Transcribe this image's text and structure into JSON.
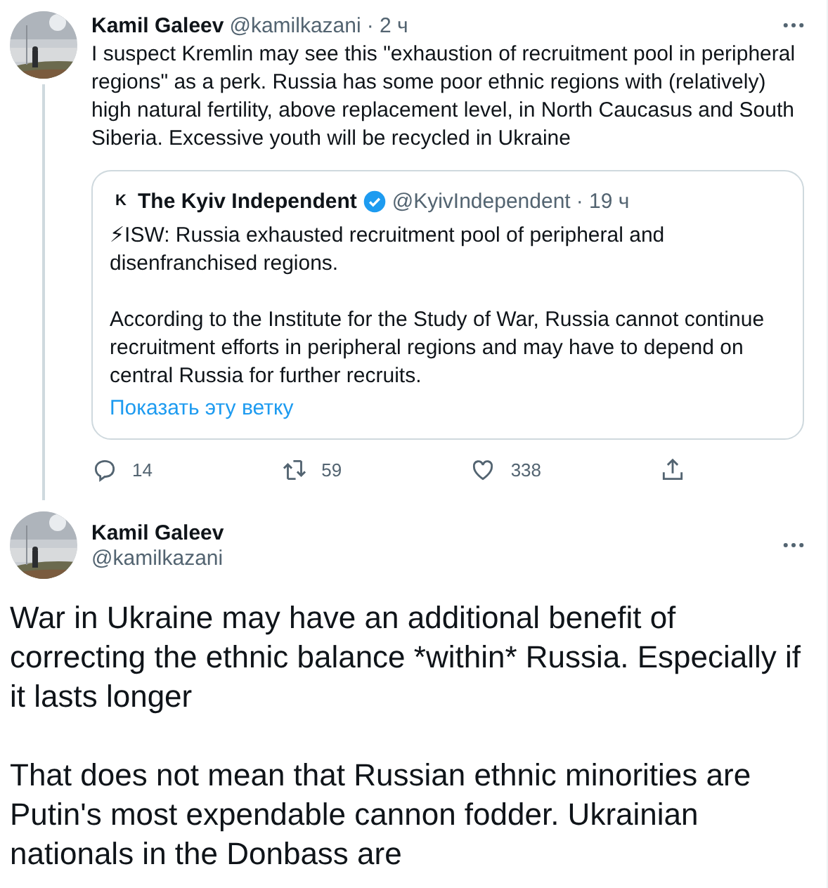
{
  "tweets": [
    {
      "name": "Kamil Galeev",
      "handle": "@kamilkazani",
      "time": "· 2 ч",
      "text": "I suspect Kremlin may see this \"exhaustion of recruitment pool in peripheral regions\" as a perk. Russia has some poor ethnic regions with (relatively) high natural fertility, above replacement level, in North Caucasus and South Siberia. Excessive youth will be recycled in Ukraine",
      "quote": {
        "logo": "K",
        "name": "The Kyiv Independent",
        "verified": true,
        "handle": "@KyivIndependent",
        "time": "· 19 ч",
        "paragraphs": [
          "⚡ISW: Russia exhausted recruitment pool of peripheral and disenfranchised regions.",
          "According to the Institute for the Study of War, Russia cannot continue recruitment efforts in peripheral regions and may have to depend on central Russia for further recruits."
        ],
        "link": "Показать эту ветку"
      },
      "actions": [
        {
          "kind": "reply",
          "count": "14"
        },
        {
          "kind": "retweet",
          "count": "59"
        },
        {
          "kind": "like",
          "count": "338"
        },
        {
          "kind": "share"
        }
      ]
    }
  ],
  "focused": {
    "name": "Kamil Galeev",
    "handle": "@kamilkazani",
    "paragraphs": [
      "War in Ukraine may have an additional benefit of correcting the ethnic balance *within* Russia. Especially if it lasts longer",
      "That does not mean that Russian ethnic minorities are Putin's most expendable cannon fodder. Ukrainian nationals in the Donbass are"
    ]
  }
}
